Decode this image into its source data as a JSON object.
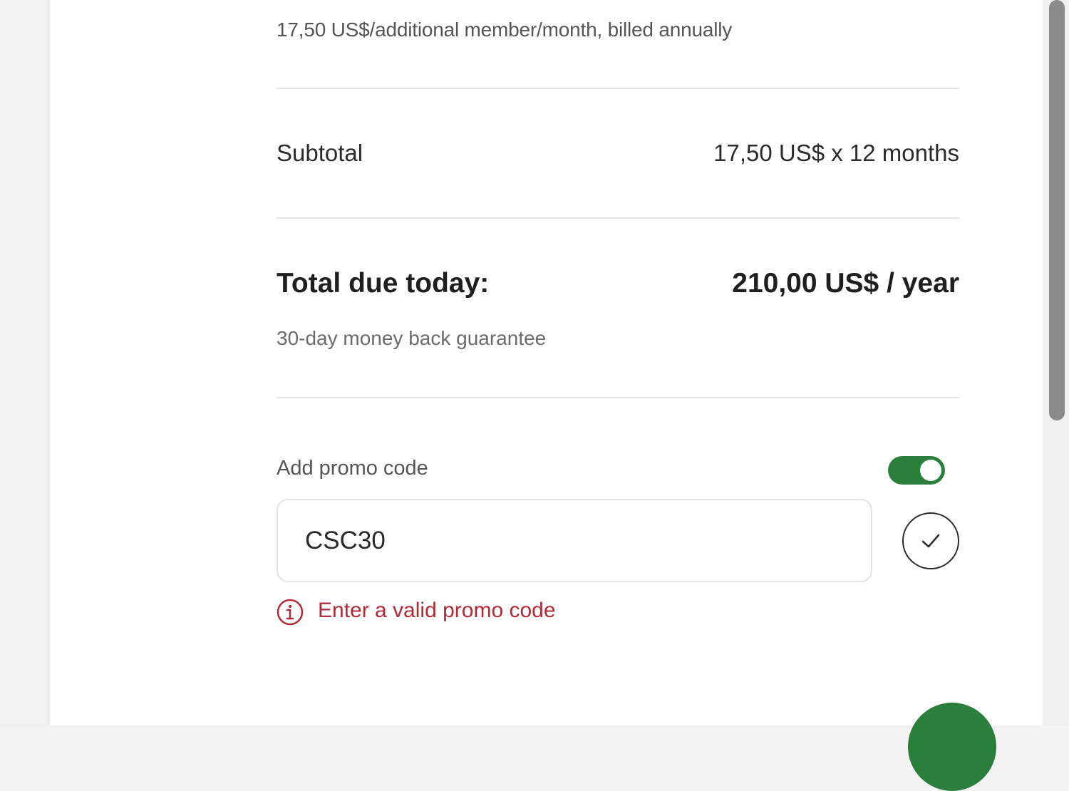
{
  "summary": {
    "billing_note": "17,50 US$/additional member/month, billed annually",
    "subtotal_label": "Subtotal",
    "subtotal_value": "17,50 US$ x 12 months",
    "total_label": "Total due today:",
    "total_value": "210,00 US$ / year",
    "guarantee": "30-day money back guarantee"
  },
  "promo": {
    "label": "Add promo code",
    "toggle_on": true,
    "input_value": "CSC30",
    "error_text": "Enter a valid promo code"
  },
  "icons": {
    "apply": "checkmark-icon",
    "error": "info-icon"
  },
  "colors": {
    "accent": "#2a7f3b",
    "error": "#b02a37"
  }
}
